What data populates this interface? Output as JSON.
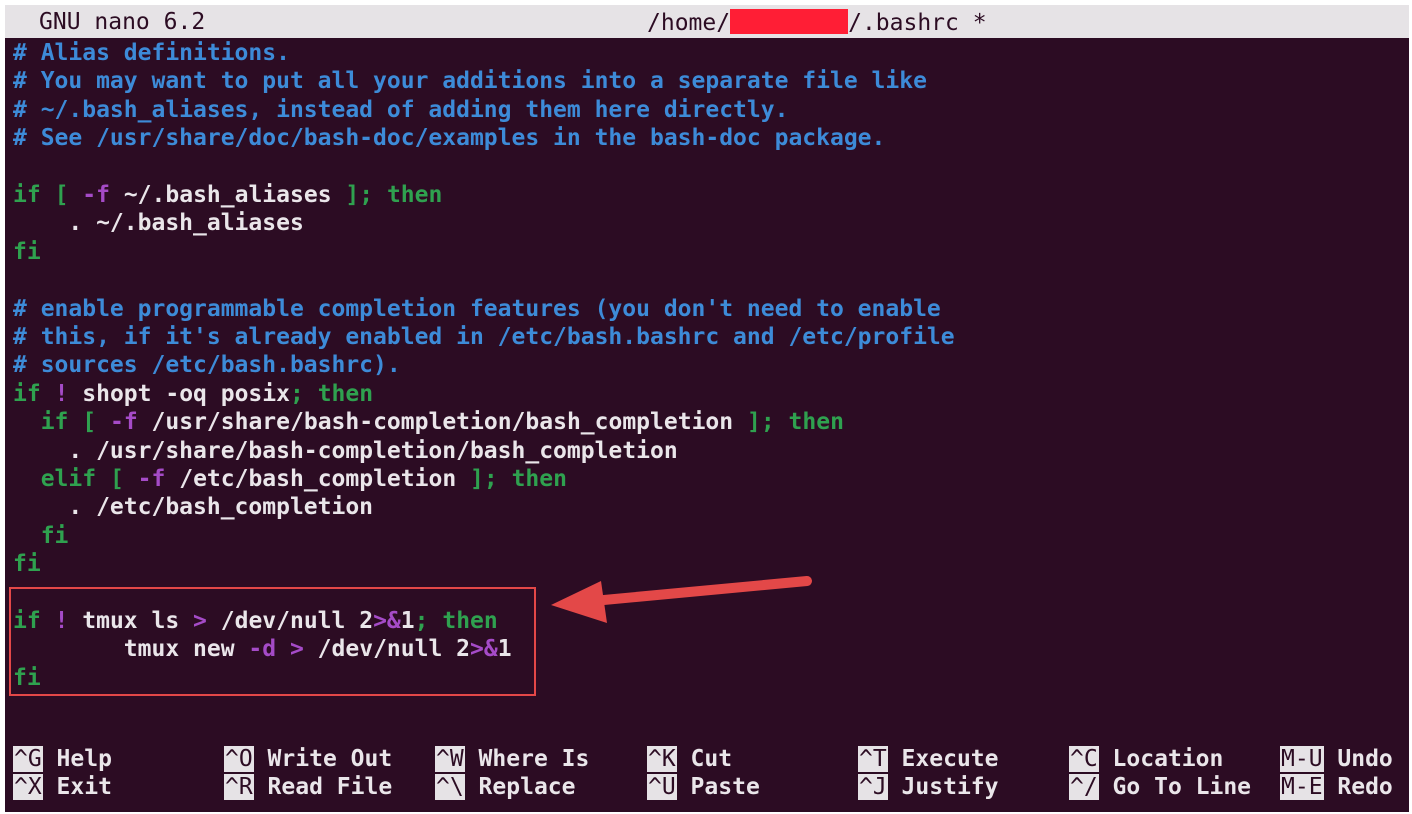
{
  "titlebar": {
    "app": "GNU nano 6.2",
    "path_prefix": "/home/",
    "path_suffix": "/.bashrc *"
  },
  "lines": [
    [
      {
        "t": "# Alias definitions.",
        "c": "c"
      }
    ],
    [
      {
        "t": "# You may want to put all your additions into a separate file like",
        "c": "c"
      }
    ],
    [
      {
        "t": "# ~/.bash_aliases, instead of adding them here directly.",
        "c": "c"
      }
    ],
    [
      {
        "t": "# See /usr/share/doc/bash-doc/examples in the bash-doc package.",
        "c": "c"
      }
    ],
    [],
    [
      {
        "t": "if",
        "c": "kw"
      },
      {
        "t": " ",
        "c": "tx"
      },
      {
        "t": "[",
        "c": "kw"
      },
      {
        "t": " ",
        "c": "tx"
      },
      {
        "t": "-f",
        "c": "op"
      },
      {
        "t": " ~/.bash_aliases ",
        "c": "tx"
      },
      {
        "t": "];",
        "c": "kw"
      },
      {
        "t": " ",
        "c": "tx"
      },
      {
        "t": "then",
        "c": "kw"
      }
    ],
    [
      {
        "t": "    . ~/.bash_aliases",
        "c": "tx"
      }
    ],
    [
      {
        "t": "fi",
        "c": "kw"
      }
    ],
    [],
    [
      {
        "t": "# enable programmable completion features (you don't need to enable",
        "c": "c"
      }
    ],
    [
      {
        "t": "# this, if it's already enabled in /etc/bash.bashrc and /etc/profile",
        "c": "c"
      }
    ],
    [
      {
        "t": "# sources /etc/bash.bashrc).",
        "c": "c"
      }
    ],
    [
      {
        "t": "if",
        "c": "kw"
      },
      {
        "t": " ",
        "c": "tx"
      },
      {
        "t": "!",
        "c": "op"
      },
      {
        "t": " shopt -oq posix",
        "c": "tx"
      },
      {
        "t": ";",
        "c": "kw"
      },
      {
        "t": " ",
        "c": "tx"
      },
      {
        "t": "then",
        "c": "kw"
      }
    ],
    [
      {
        "t": "  ",
        "c": "tx"
      },
      {
        "t": "if",
        "c": "kw"
      },
      {
        "t": " ",
        "c": "tx"
      },
      {
        "t": "[",
        "c": "kw"
      },
      {
        "t": " ",
        "c": "tx"
      },
      {
        "t": "-f",
        "c": "op"
      },
      {
        "t": " /usr/share/bash-completion/bash_completion ",
        "c": "tx"
      },
      {
        "t": "];",
        "c": "kw"
      },
      {
        "t": " ",
        "c": "tx"
      },
      {
        "t": "then",
        "c": "kw"
      }
    ],
    [
      {
        "t": "    . /usr/share/bash-completion/bash_completion",
        "c": "tx"
      }
    ],
    [
      {
        "t": "  ",
        "c": "tx"
      },
      {
        "t": "elif",
        "c": "kw"
      },
      {
        "t": " ",
        "c": "tx"
      },
      {
        "t": "[",
        "c": "kw"
      },
      {
        "t": " ",
        "c": "tx"
      },
      {
        "t": "-f",
        "c": "op"
      },
      {
        "t": " /etc/bash_completion ",
        "c": "tx"
      },
      {
        "t": "];",
        "c": "kw"
      },
      {
        "t": " ",
        "c": "tx"
      },
      {
        "t": "then",
        "c": "kw"
      }
    ],
    [
      {
        "t": "    . /etc/bash_completion",
        "c": "tx"
      }
    ],
    [
      {
        "t": "  ",
        "c": "tx"
      },
      {
        "t": "fi",
        "c": "kw"
      }
    ],
    [
      {
        "t": "fi",
        "c": "kw"
      }
    ],
    [],
    [
      {
        "t": "if",
        "c": "kw"
      },
      {
        "t": " ",
        "c": "tx"
      },
      {
        "t": "!",
        "c": "op"
      },
      {
        "t": " tmux ls ",
        "c": "tx"
      },
      {
        "t": ">",
        "c": "op"
      },
      {
        "t": " /dev/null 2",
        "c": "tx"
      },
      {
        "t": ">&",
        "c": "op"
      },
      {
        "t": "1",
        "c": "tx"
      },
      {
        "t": ";",
        "c": "kw"
      },
      {
        "t": " ",
        "c": "tx"
      },
      {
        "t": "then",
        "c": "kw"
      }
    ],
    [
      {
        "t": "        tmux new ",
        "c": "tx"
      },
      {
        "t": "-d",
        "c": "op"
      },
      {
        "t": " ",
        "c": "tx"
      },
      {
        "t": ">",
        "c": "op"
      },
      {
        "t": " /dev/null 2",
        "c": "tx"
      },
      {
        "t": ">&",
        "c": "op"
      },
      {
        "t": "1",
        "c": "tx"
      }
    ],
    [
      {
        "t": "fi",
        "c": "kw"
      }
    ]
  ],
  "shortcuts": [
    {
      "key": "^G",
      "label": "Help"
    },
    {
      "key": "^X",
      "label": "Exit"
    },
    {
      "key": "^O",
      "label": "Write Out"
    },
    {
      "key": "^R",
      "label": "Read File"
    },
    {
      "key": "^W",
      "label": "Where Is"
    },
    {
      "key": "^\\",
      "label": "Replace"
    },
    {
      "key": "^K",
      "label": "Cut"
    },
    {
      "key": "^U",
      "label": "Paste"
    },
    {
      "key": "^T",
      "label": "Execute"
    },
    {
      "key": "^J",
      "label": "Justify"
    },
    {
      "key": "^C",
      "label": "Location"
    },
    {
      "key": "^/",
      "label": "Go To Line"
    },
    {
      "key": "M-U",
      "label": "Undo"
    },
    {
      "key": "M-E",
      "label": "Redo"
    }
  ],
  "colors": {
    "background": "#2c0c23",
    "comment": "#3d8bd8",
    "keyword": "#2fa14f",
    "operator": "#a54bc7",
    "text": "#eae6ea",
    "annotation": "#e34848"
  }
}
